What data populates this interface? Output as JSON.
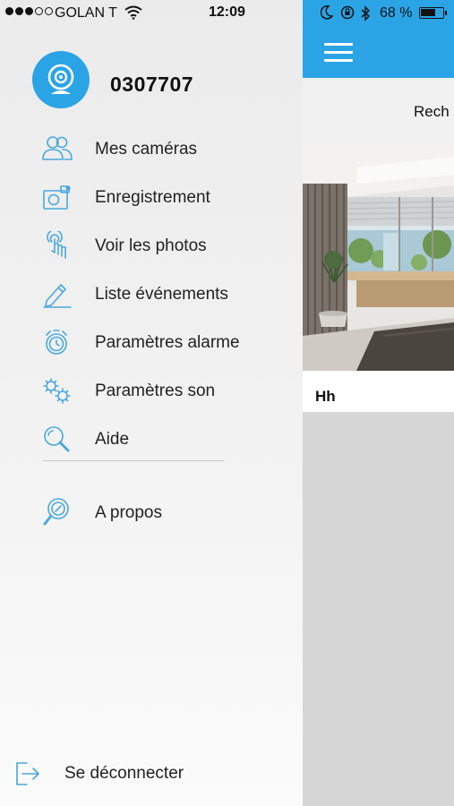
{
  "status_bar": {
    "carrier": "GOLAN T",
    "time": "12:09",
    "battery_percent": "68 %",
    "battery_level": 0.68
  },
  "drawer": {
    "device_id": "0307707",
    "items": [
      {
        "label": "Mes caméras",
        "icon": "users-icon"
      },
      {
        "label": "Enregistrement",
        "icon": "camera-record-icon"
      },
      {
        "label": "Voir les photos",
        "icon": "touch-hand-icon"
      },
      {
        "label": "Liste événements",
        "icon": "pencil-icon"
      },
      {
        "label": "Paramètres alarme",
        "icon": "alarm-clock-icon"
      },
      {
        "label": "Paramètres son",
        "icon": "gears-icon"
      },
      {
        "label": "Aide",
        "icon": "search-icon"
      }
    ],
    "about": {
      "label": "A propos",
      "icon": "about-magnifier-icon"
    },
    "logout": {
      "label": "Se déconnecter",
      "icon": "logout-icon"
    }
  },
  "main": {
    "search_label": "Rech",
    "camera": {
      "name": "Hh"
    }
  },
  "colors": {
    "accent": "#2ba4e6",
    "icon": "#4aa8de"
  }
}
